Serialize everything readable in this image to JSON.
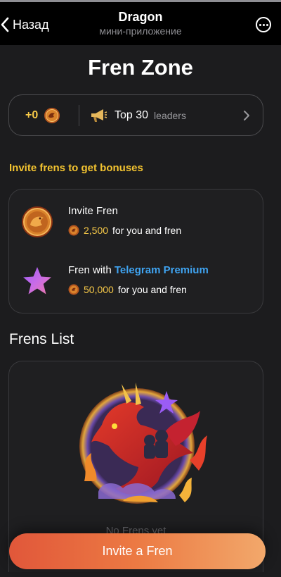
{
  "topbar": {
    "back_label": "Назад",
    "title": "Dragon",
    "subtitle": "мини-приложение"
  },
  "page": {
    "title": "Fren Zone"
  },
  "stats": {
    "balance": "+0",
    "leaders_label": "Top 30",
    "leaders_sub": "leaders"
  },
  "invite": {
    "heading": "Invite frens to get bonuses",
    "items": [
      {
        "title": "Invite Fren",
        "amount": "2,500",
        "suffix": "for you and fren"
      },
      {
        "title_prefix": "Fren with",
        "title_highlight": "Telegram Premium",
        "amount": "50,000",
        "suffix": "for you and fren"
      }
    ]
  },
  "frens": {
    "title": "Frens List",
    "empty_text": "No Frens yet"
  },
  "cta": {
    "label": "Invite a Fren"
  },
  "colors": {
    "background": "#1c1c1e",
    "accent_gold": "#f4c430",
    "premium_blue": "#3fa3f0",
    "button_start": "#e1573a",
    "button_end": "#f2a86b"
  },
  "icons": {
    "back": "chevron-left-icon",
    "more": "more-icon",
    "coin": "dragon-coin-icon",
    "leaders": "megaphone-icon",
    "premium": "star-icon",
    "chevron": "chevron-right-icon"
  }
}
